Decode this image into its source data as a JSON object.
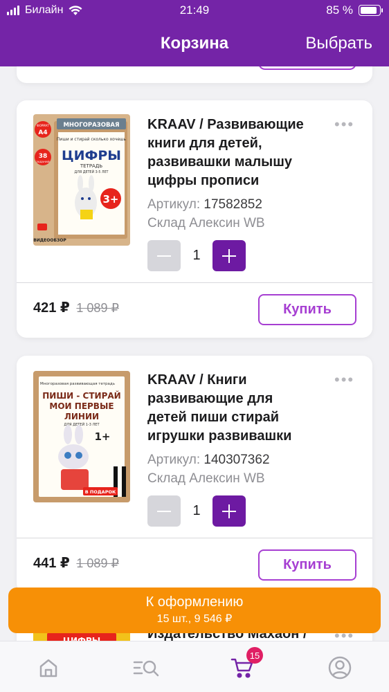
{
  "status_bar": {
    "carrier": "Билайн",
    "time": "21:49",
    "battery": "85 %"
  },
  "nav": {
    "title": "Корзина",
    "select_label": "Выбрать"
  },
  "cart_items": [
    {
      "title": "KRAAV / Развивающие книги для детей, развивашки малышу цифры прописи",
      "title_lines": [
        "KRAAV / Развивающие",
        "книги для детей,",
        "развивашки малышу",
        "цифры прописи"
      ],
      "article_label": "Артикул:",
      "article": "17582852",
      "warehouse": "Склад Алексин WB",
      "quantity": "1",
      "price": "421 ₽",
      "old_price": "1 089 ₽",
      "buy_label": "Купить",
      "cover": {
        "badge_top": "ФОРМАТ",
        "badge_format": "А4",
        "badge_count": "38",
        "badge_tasks": "ЗАДАНИЙ",
        "ribbon": "МНОГОРАЗОВАЯ",
        "subtitle": "Пиши и стирай сколько хочешь",
        "main": "ЦИФРЫ",
        "tetrad": "ТЕТРАДЬ",
        "age_line": "ДЛЯ ДЕТЕЙ 3-5 ЛЕТ",
        "age": "3+",
        "video": "ВИДЕООБЗОР"
      }
    },
    {
      "title": "KRAAV / Книги развивающие для детей пиши стирай игрушки развивашки",
      "title_lines": [
        "KRAAV / Книги",
        "развивающие для",
        "детей пиши стирай",
        "игрушки развивашки"
      ],
      "article_label": "Артикул:",
      "article": "140307362",
      "warehouse": "Склад Алексин WB",
      "quantity": "1",
      "price": "441 ₽",
      "old_price": "1 089 ₽",
      "buy_label": "Купить",
      "cover": {
        "header": "Многоразовая развивающая тетрадь",
        "main1": "ПИШИ - СТИРАЙ",
        "main2": "МОИ ПЕРВЫЕ",
        "main3": "ЛИНИИ",
        "age_line": "ДЛЯ ДЕТЕЙ 1-3 ЛЕТ",
        "age": "1+",
        "gift": "В ПОДАРОК"
      }
    }
  ],
  "peek_item": {
    "title_fragment": "Издательство Махаон /",
    "cover_text": "ЦИФРЫ"
  },
  "checkout": {
    "label": "К оформлению",
    "summary": "15 шт., 9 546 ₽"
  },
  "tabbar": {
    "cart_badge": "15",
    "tabs": [
      "home-icon",
      "catalog-search-icon",
      "cart-icon",
      "profile-icon"
    ]
  },
  "colors": {
    "header": "#7424a7",
    "accent": "#a63ed2",
    "plus_button": "#6d1aa2",
    "checkout": "#f79006",
    "badge": "#e01f64"
  }
}
